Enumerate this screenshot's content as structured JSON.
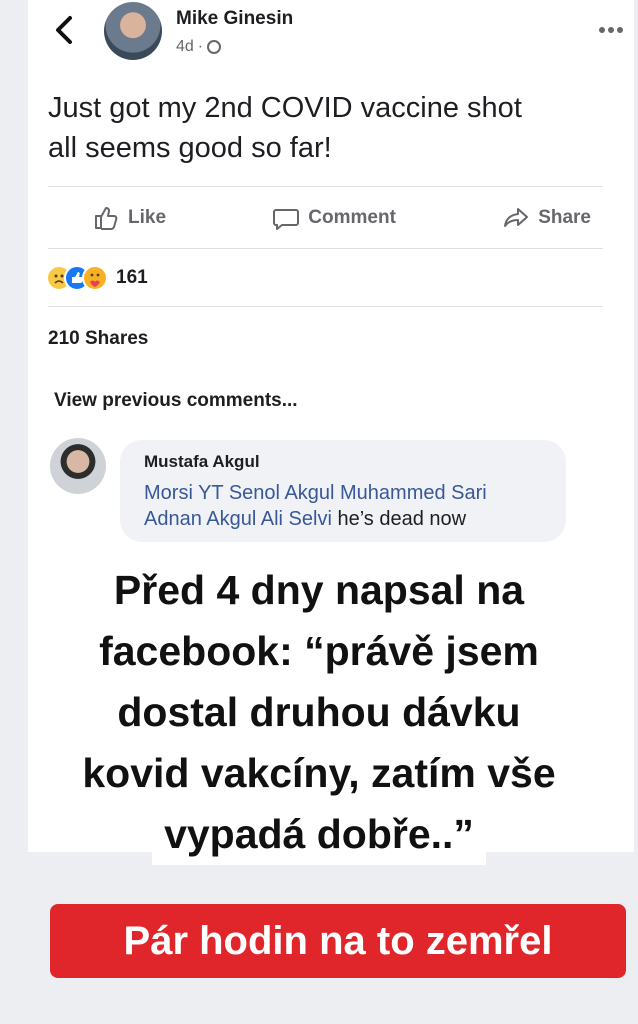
{
  "post": {
    "author": "Mike Ginesin",
    "time": "4d",
    "separator": "·",
    "text_line1": "Just got my 2nd COVID vaccine shot",
    "text_line2": "all seems good so far!"
  },
  "actions": {
    "like": "Like",
    "comment": "Comment",
    "share": "Share"
  },
  "reactions": {
    "count": "161",
    "icons": [
      "sad-reaction-icon",
      "like-reaction-icon",
      "care-reaction-icon"
    ]
  },
  "shares": "210 Shares",
  "comments": {
    "view_previous": "View previous comments...",
    "item": {
      "author": "Mustafa Akgul",
      "tags_line1": "Morsi YT Senol Akgul Muhammed Sari",
      "tags_line2": "Adnan Akgul Ali Selvi",
      "text": "he’s dead now"
    }
  },
  "overlay": {
    "line1": "Před 4 dny napsal na",
    "line2": "facebook: “právě jsem",
    "line3": "dostal druhou dávku",
    "line4": "kovid  vakcíny, zatím vše",
    "line5": "vypadá dobře..”"
  },
  "banner": "Pár hodin na to zemřel",
  "colors": {
    "banner": "#e0262b",
    "tag_link": "#385898",
    "like_blue": "#1877f2"
  }
}
